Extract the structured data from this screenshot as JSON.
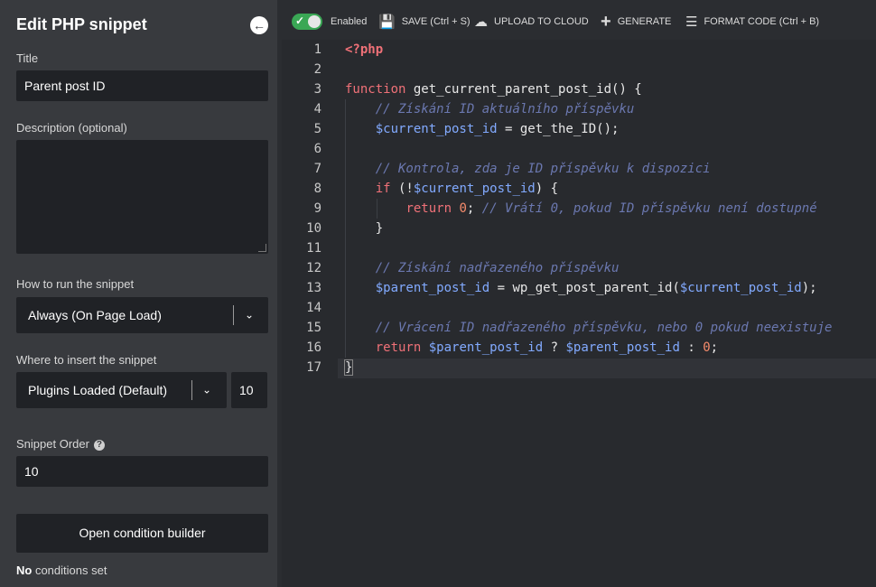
{
  "panel": {
    "title": "Edit PHP snippet",
    "back_icon": "arrow-left-circle-icon",
    "title_label": "Title",
    "title_value": "Parent post ID",
    "description_label": "Description (optional)",
    "description_value": "",
    "run_label": "How to run the snippet",
    "run_value": "Always (On Page Load)",
    "insert_label": "Where to insert the snippet",
    "insert_value": "Plugins Loaded (Default)",
    "insert_priority": "10",
    "order_label": "Snippet Order",
    "order_value": "10",
    "condition_button": "Open condition builder",
    "conditions_bold": "No",
    "conditions_rest": " conditions set"
  },
  "toolbar": {
    "enabled_label": "Enabled",
    "save_label": "SAVE (Ctrl + S)",
    "upload_label": "UPLOAD TO CLOUD",
    "generate_label": "GENERATE",
    "format_label": "FORMAT CODE (Ctrl + B)"
  },
  "editor": {
    "line_numbers": [
      "1",
      "2",
      "3",
      "4",
      "5",
      "6",
      "7",
      "8",
      "9",
      "10",
      "11",
      "12",
      "13",
      "14",
      "15",
      "16",
      "17"
    ],
    "lines": {
      "l1": "<?php",
      "l3_kw": "function",
      "l3_rest": " get_current_parent_post_id() {",
      "l4": "// Získání ID aktuálního příspěvku",
      "l5_var": "$current_post_id",
      "l5_rest": " = get_the_ID();",
      "l7": "// Kontrola, zda je ID příspěvku k dispozici",
      "l8_kw": "if",
      "l8_a": " (!",
      "l8_var": "$current_post_id",
      "l8_b": ") {",
      "l9_kw": "return",
      "l9_num": "0",
      "l9_semi": ";",
      "l9_cm": "// Vrátí 0, pokud ID příspěvku není dostupné",
      "l10": "}",
      "l12": "// Získání nadřazeného příspěvku",
      "l13_var1": "$parent_post_id",
      "l13_a": " = wp_get_post_parent_id(",
      "l13_var2": "$current_post_id",
      "l13_b": ");",
      "l15": "// Vrácení ID nadřazeného příspěvku, nebo 0 pokud neexistuje",
      "l16_kw": "return",
      "l16_var1": "$parent_post_id",
      "l16_a": " ? ",
      "l16_var2": "$parent_post_id",
      "l16_b": " : ",
      "l16_num": "0",
      "l16_c": ";",
      "l17": "}"
    }
  }
}
